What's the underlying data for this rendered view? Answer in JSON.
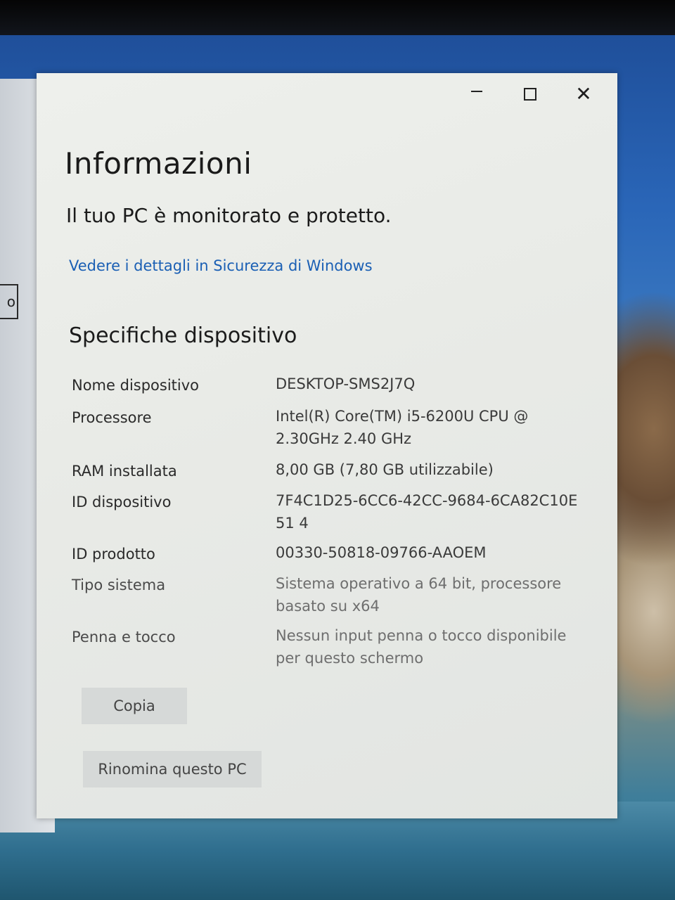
{
  "window": {
    "title": "Informazioni",
    "status": "Il tuo PC è monitorato e protetto.",
    "security_link": "Vedere i dettagli in Sicurezza di Windows",
    "section_title": "Specifiche dispositivo",
    "specs": [
      {
        "label": "Nome dispositivo",
        "value": "DESKTOP-SMS2J7Q"
      },
      {
        "label": "Processore",
        "value": "Intel(R) Core(TM) i5-6200U CPU @ 2.30GHz   2.40 GHz"
      },
      {
        "label": "RAM installata",
        "value": "8,00 GB (7,80 GB utilizzabile)"
      },
      {
        "label": "ID dispositivo",
        "value": "7F4C1D25-6CC6-42CC-9684-6CA82C10E51 4"
      },
      {
        "label": "ID prodotto",
        "value": "00330-50818-09766-AAOEM"
      },
      {
        "label": "Tipo sistema",
        "value": "Sistema operativo a 64 bit, processore basato su x64"
      },
      {
        "label": "Penna e tocco",
        "value": "Nessun input penna o tocco disponibile per questo schermo"
      }
    ],
    "buttons": {
      "copy": "Copia",
      "rename": "Rinomina questo PC"
    },
    "controls": {
      "minimize_icon": "minimize-icon",
      "maximize_icon": "maximize-icon",
      "close_icon": "close-icon"
    }
  },
  "background": {
    "back_window_fragment": "o"
  },
  "colors": {
    "link": "#1a5fb4",
    "window_bg": "#eef0ec",
    "button_bg": "#d6d9d8"
  }
}
